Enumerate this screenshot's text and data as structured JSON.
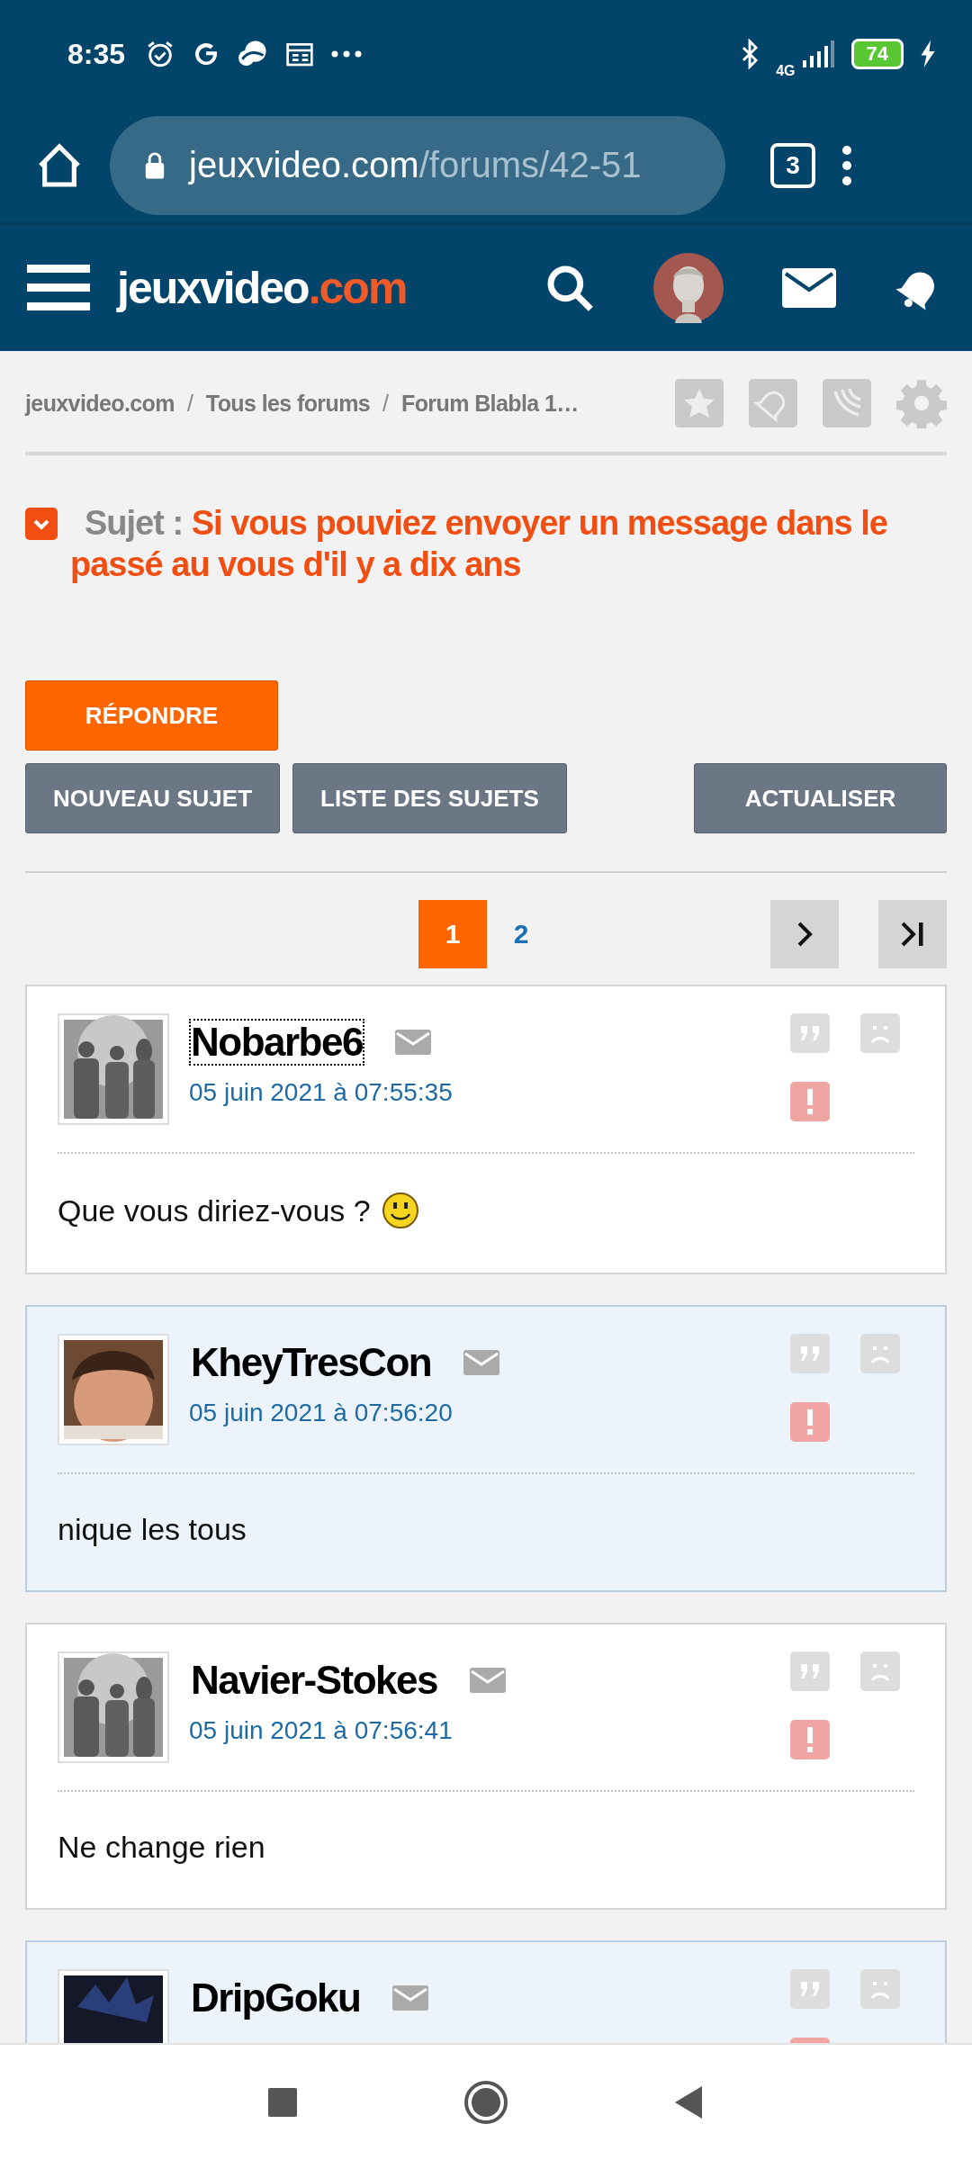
{
  "status_bar": {
    "time": "8:35",
    "network": "4G",
    "battery": "74"
  },
  "browser": {
    "url_domain": "jeuxvideo.com",
    "url_path": "/forums/42-51",
    "tab_count": "3"
  },
  "site": {
    "logo_main": "jeuxvideo",
    "logo_suffix": ".com"
  },
  "breadcrumb": {
    "items": [
      "jeuxvideo.com",
      "Tous les forums",
      "Forum Blabla 1…"
    ],
    "separators": [
      "/",
      "/"
    ]
  },
  "topic": {
    "label": "Sujet :",
    "title": "Si vous pouviez envoyer un message dans le passé au vous d'il y a dix ans"
  },
  "actions": {
    "primary": "RÉPONDRE",
    "secondary": [
      "NOUVEAU SUJET",
      "LISTE DES SUJETS"
    ],
    "refresh": "ACTUALISER"
  },
  "pagination": {
    "pages": [
      {
        "label": "1",
        "selected": true
      },
      {
        "label": "2",
        "selected": false
      }
    ]
  },
  "posts": [
    {
      "author": "Nobarbe6",
      "date": "05 juin 2021 à 07:55:35",
      "message": "Que vous diriez-vous ?",
      "smiley": true,
      "shaded": false,
      "focused": true,
      "avatar": {
        "kind": "group"
      }
    },
    {
      "author": "KheyTresCon",
      "date": "05 juin 2021 à 07:56:20",
      "message": "nique les tous",
      "smiley": false,
      "shaded": true,
      "focused": false
    },
    {
      "author": "Navier-Stokes",
      "date": "05 juin 2021 à 07:56:41",
      "message": "Ne change rien",
      "smiley": false,
      "shaded": false,
      "focused": false,
      "avatar": {
        "kind": "group"
      }
    },
    {
      "author": "DripGoku",
      "shaded": true,
      "focused": false,
      "avatar": {
        "kind": "dark"
      }
    }
  ]
}
